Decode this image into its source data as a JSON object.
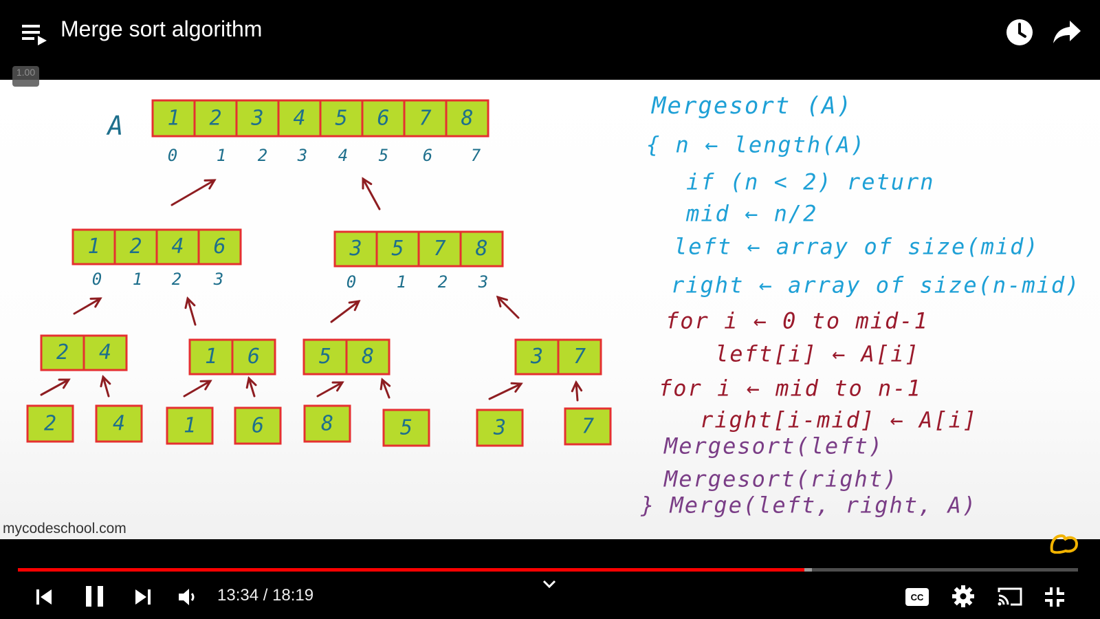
{
  "player": {
    "title": "Merge sort algorithm",
    "speed": "1.00",
    "current_time": "13:34",
    "duration": "18:19",
    "time_display": "13:34 / 18:19",
    "progress": 0.742,
    "buffered": 0.749,
    "accent": "#ff0000"
  },
  "icons": [
    "playlist-icon",
    "watch-later-icon",
    "share-icon",
    "previous-icon",
    "pause-icon",
    "next-icon",
    "volume-icon",
    "chevron-down-icon",
    "captions-icon",
    "settings-icon",
    "cast-icon",
    "exit-fullscreen-icon"
  ],
  "board": {
    "array_label": "A",
    "top_values": [
      "1",
      "2",
      "3",
      "4",
      "5",
      "6",
      "7",
      "8"
    ],
    "top_indices": [
      "0",
      "1",
      "2",
      "3",
      "4",
      "5",
      "6",
      "7"
    ],
    "left_half": [
      "1",
      "2",
      "4",
      "6"
    ],
    "left_indices": [
      "0",
      "1",
      "2",
      "3"
    ],
    "right_half": [
      "3",
      "5",
      "7",
      "8"
    ],
    "right_indices": [
      "0",
      "1",
      "2",
      "3"
    ],
    "pairs": [
      [
        "2",
        "4"
      ],
      [
        "1",
        "6"
      ],
      [
        "5",
        "8"
      ],
      [
        "3",
        "7"
      ]
    ],
    "singles": [
      "2",
      "4",
      "1",
      "6",
      "8",
      "5",
      "3",
      "7"
    ],
    "code": [
      "Mergesort (A)",
      "{  n ← length(A)",
      "if (n < 2) return",
      "mid ← n/2",
      "left ← array of size(mid)",
      "right ← array of size(n-mid)",
      "for i ← 0 to mid-1",
      "left[i] ← A[i]",
      "for i ← mid to n-1",
      "right[i-mid] ← A[i]",
      "Mergesort(left)",
      "Mergesort(right)",
      "} Merge(left, right, A)"
    ],
    "watermark": "mycodeschool.com",
    "colors": {
      "cell_fill": "#b7db2c",
      "cell_border": "#e53030",
      "digit": "#1e6f8c",
      "code_blue": "#1ea0d6",
      "code_red": "#9a1a2c",
      "code_purple": "#7a3d86",
      "arrow": "#8e1d21"
    }
  }
}
